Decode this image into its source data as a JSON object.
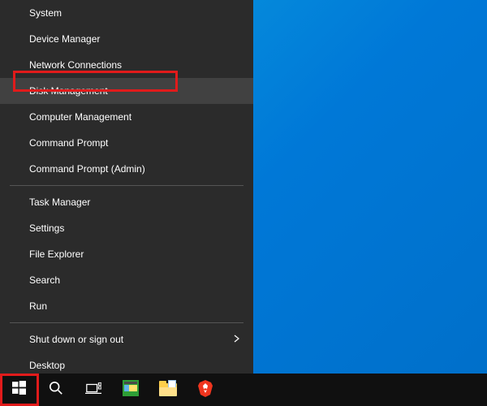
{
  "menu": {
    "items": [
      {
        "id": "system",
        "label": "System"
      },
      {
        "id": "device-manager",
        "label": "Device Manager"
      },
      {
        "id": "network-connections",
        "label": "Network Connections"
      },
      {
        "id": "disk-management",
        "label": "Disk Management"
      },
      {
        "id": "computer-management",
        "label": "Computer Management"
      },
      {
        "id": "command-prompt",
        "label": "Command Prompt"
      },
      {
        "id": "command-prompt-admin",
        "label": "Command Prompt (Admin)"
      },
      {
        "id": "task-manager",
        "label": "Task Manager"
      },
      {
        "id": "settings",
        "label": "Settings"
      },
      {
        "id": "file-explorer",
        "label": "File Explorer"
      },
      {
        "id": "search",
        "label": "Search"
      },
      {
        "id": "run",
        "label": "Run"
      },
      {
        "id": "shutdown",
        "label": "Shut down or sign out"
      },
      {
        "id": "desktop",
        "label": "Desktop"
      }
    ]
  },
  "highlighted_item": "disk-management",
  "annotations": {
    "start_button": true,
    "disk_management": true
  },
  "colors": {
    "menu_bg": "#2b2b2b",
    "menu_highlight": "#414141",
    "taskbar_bg": "#101010",
    "annotation": "#e11b1b",
    "desktop_accent": "#0078d7"
  }
}
